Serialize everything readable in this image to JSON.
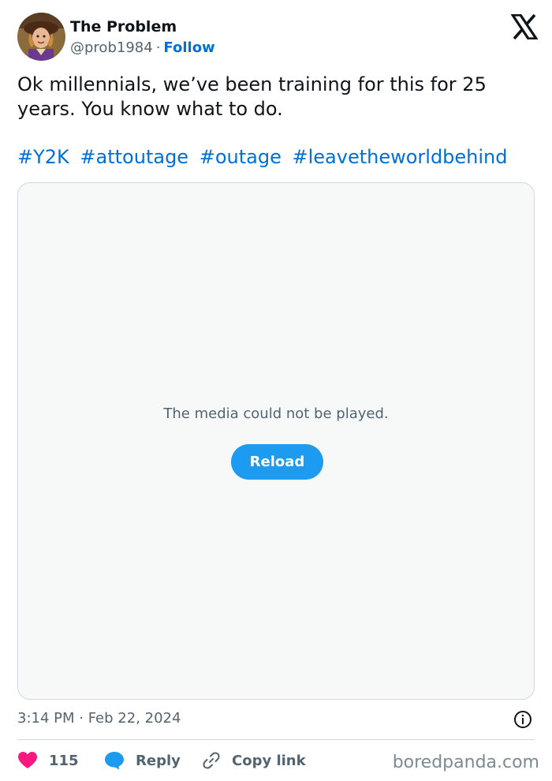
{
  "author": {
    "name": "The Problem",
    "handle": "@prob1984",
    "separator": "·",
    "follow_label": "Follow"
  },
  "tweet": {
    "text": "Ok millennials, we’ve been training for this for 25 years. You know what to do.",
    "hashtags": [
      "#Y2K",
      "#attoutage",
      "#outage",
      "#leavetheworldbehind"
    ],
    "timestamp": "3:14 PM · Feb 22, 2024"
  },
  "media": {
    "error_text": "The media could not be played.",
    "reload_label": "Reload"
  },
  "actions": {
    "likes_count": "115",
    "reply_label": "Reply",
    "copy_link_label": "Copy link"
  },
  "watermark": "boredpanda.com",
  "icons": {
    "platform_logo": "x-logo-icon",
    "info": "info-icon",
    "like": "heart-icon",
    "reply": "speech-bubble-icon",
    "copy_link": "link-icon"
  },
  "colors": {
    "link_blue": "#006fd6",
    "button_blue": "#1d9bf0",
    "heart_pink": "#f91880",
    "muted_text": "#536471",
    "media_background": "#f7f9f9"
  }
}
